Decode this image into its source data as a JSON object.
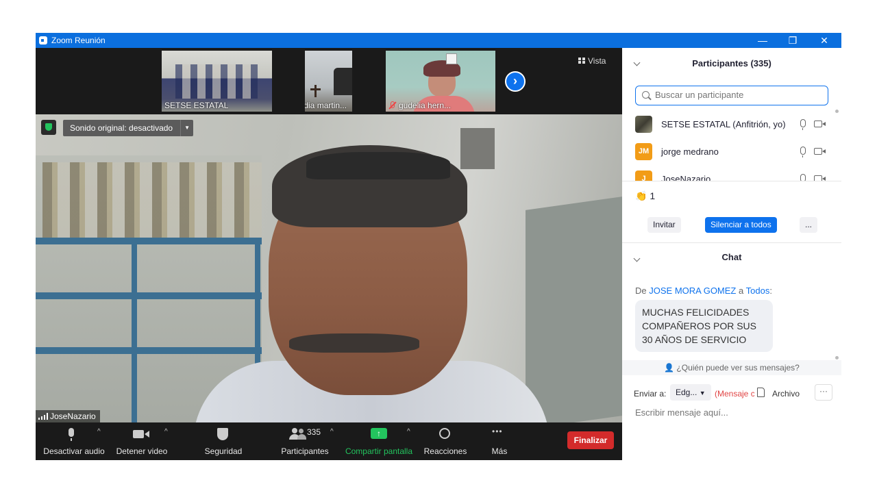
{
  "window": {
    "title": "Zoom Reunión",
    "minimize": "—",
    "restore": "❐",
    "close": "✕"
  },
  "gallery": {
    "thumbnails": [
      {
        "name": "SETSE ESTATAL",
        "muted": false
      },
      {
        "name": "Elodia martin...",
        "muted": true
      },
      {
        "name": "gudelia hern...",
        "muted": true
      }
    ],
    "next_icon": "›",
    "view_label": "Vista"
  },
  "main_video": {
    "audio_dropdown": "Sonido original: desactivado",
    "speaker_name": "JoseNazario"
  },
  "toolbar": {
    "mute_audio": "Desactivar audio",
    "stop_video": "Detener video",
    "security": "Seguridad",
    "participants": "Participantes",
    "participants_count": "335",
    "share_screen": "Compartir pantalla",
    "reactions": "Reacciones",
    "more": "Más",
    "end": "Finalizar",
    "more_icon": "•••"
  },
  "participants_panel": {
    "title": "Participantes (335)",
    "search_placeholder": "Buscar un participante",
    "people": [
      {
        "initials": "",
        "name": "SETSE ESTATAL (Anfitrión, yo)",
        "color": "#6b6a55"
      },
      {
        "initials": "JM",
        "name": "jorge medrano",
        "color": "#f29c17"
      },
      {
        "initials": "J",
        "name": "JoseNazario",
        "color": "#f29c17"
      }
    ],
    "reaction_emoji": "👏",
    "reaction_count": "1",
    "invite": "Invitar",
    "mute_all": "Silenciar a todos",
    "more": "..."
  },
  "chat_panel": {
    "title": "Chat",
    "from_prefix": "De",
    "sender": "JOSE MORA GOMEZ",
    "to_word": "a",
    "recipient": "Todos",
    "message": "MUCHAS FELICIDADES COMPAÑEROS POR SUS 30 AÑOS DE SERVICIO",
    "who_can_see": "¿Quién puede ver sus mensajes?",
    "send_to_label": "Enviar a:",
    "send_to_value": "Edg...",
    "message_type": "(Mensaje c",
    "file_label": "Archivo",
    "more": "···",
    "input_placeholder": "Escribir mensaje aquí..."
  },
  "colors": {
    "zoom_blue": "#0e72ed",
    "end_red": "#d32b2b",
    "share_green": "#23c45e"
  }
}
